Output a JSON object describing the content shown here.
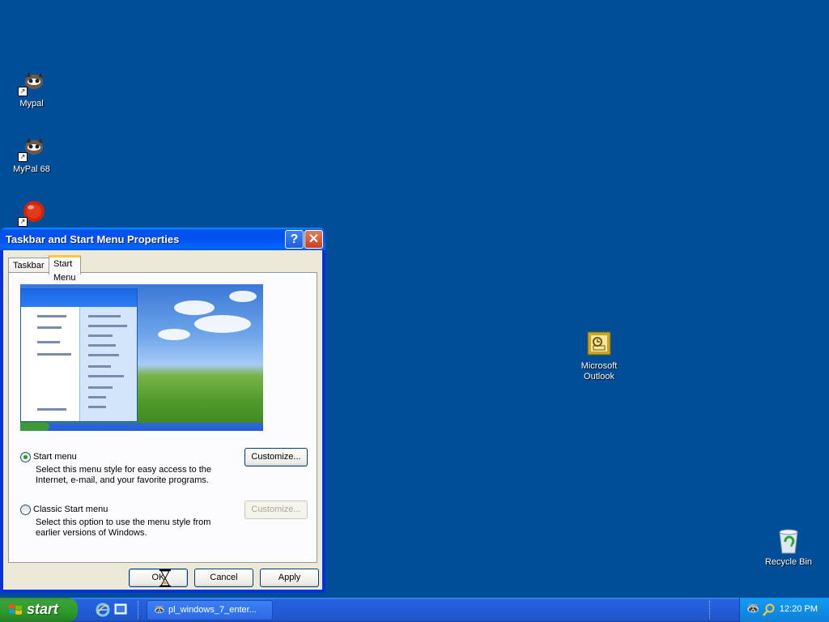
{
  "desktop": {
    "icons": [
      {
        "label": "Mypal",
        "icon": "raccoon-icon"
      },
      {
        "label": "MyPal 68",
        "icon": "raccoon-icon"
      },
      {
        "label": "",
        "icon": "red-ball-icon"
      },
      {
        "label": "Microsoft\nOutlook",
        "icon": "outlook-icon"
      },
      {
        "label": "Recycle Bin",
        "icon": "recycle-bin-icon"
      }
    ]
  },
  "dialog": {
    "title": "Taskbar and Start Menu Properties",
    "tabs": [
      {
        "label": "Taskbar",
        "active": false
      },
      {
        "label": "Start Menu",
        "active": true
      }
    ],
    "options": [
      {
        "label": "Start menu",
        "description": "Select this menu style for easy access to the Internet, e-mail, and your favorite programs.",
        "checked": true,
        "button": "Customize..."
      },
      {
        "label": "Classic Start menu",
        "description": "Select this option to use the menu style from earlier versions of Windows.",
        "checked": false,
        "button": "Customize..."
      }
    ],
    "buttons": {
      "ok": "OK",
      "cancel": "Cancel",
      "apply": "Apply"
    }
  },
  "taskbar": {
    "start_label": "start",
    "task_label": "pl_windows_7_enter...",
    "clock": "12:20 PM"
  },
  "colors": {
    "desktop": "#004e98",
    "titlebar": "#0054e3",
    "start_button": "#39a236",
    "tray": "#108de6"
  }
}
